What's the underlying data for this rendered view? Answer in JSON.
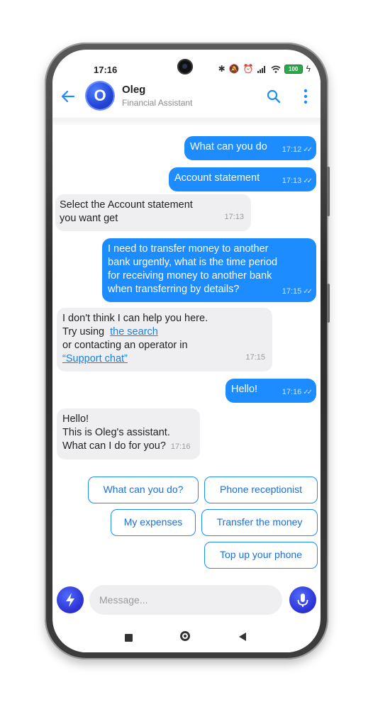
{
  "status": {
    "time": "17:16",
    "battery": "100"
  },
  "header": {
    "avatar_letter": "O",
    "name": "Oleg",
    "subtitle": "Financial Assistant"
  },
  "messages": [
    {
      "dir": "out",
      "text": "What can you do",
      "time": "17:12"
    },
    {
      "dir": "out",
      "text": "Account statement",
      "time": "17:13"
    },
    {
      "dir": "in",
      "line1": "Select the Account statement",
      "line2": "you want get",
      "time": "17:13"
    },
    {
      "dir": "out",
      "line1": "I need to transfer money to another",
      "line2": "bank urgently, what is the time period",
      "line3": "for receiving money to another bank",
      "line4": "when transferring by details?",
      "time": "17:15"
    },
    {
      "dir": "in",
      "line1": "I don't think I can help you here.",
      "line2_prefix": "Try using",
      "link1": "the search",
      "line3": "or contacting an operator in",
      "link2": "“Support chat”",
      "time": "17:15"
    },
    {
      "dir": "out",
      "text": "Hello!",
      "time": "17:16"
    },
    {
      "dir": "in",
      "line1": "Hello!",
      "line2": "This is Oleg's assistant.",
      "line3": "What can I do for you?",
      "time": "17:16"
    }
  ],
  "quick_replies": [
    "What can you do?",
    "Phone receptionist",
    "My expenses",
    "Transfer the money",
    "Top up your phone"
  ],
  "composer": {
    "placeholder": "Message..."
  },
  "colors": {
    "accent": "#1c8cff",
    "incoming_bubble": "#efeff2",
    "assistant_avatar": "#2446d6"
  },
  "icons": [
    "back-arrow-icon",
    "search-icon",
    "more-vertical-icon",
    "bolt-icon",
    "microphone-icon",
    "double-check-icon"
  ]
}
